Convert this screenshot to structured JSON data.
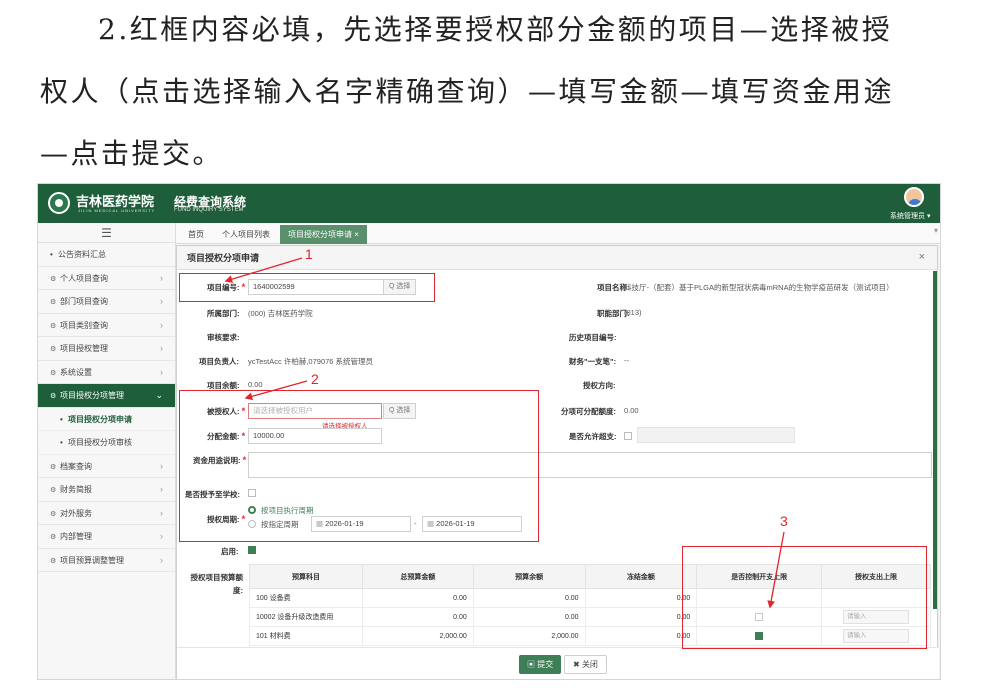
{
  "instruction": {
    "line1": "2.红框内容必填，先选择要授权部分金额的项目—选择被授",
    "line2": "权人（点击选择输入名字精确查询）—填写金额—填写资金用途",
    "line3": "—点击提交。"
  },
  "header": {
    "school_name": "吉林医药学院",
    "school_en": "JILIN MEDICAL UNIVERSITY",
    "system_title": "经费查询系统",
    "system_en": "FUND INQUIRY SYSTEM",
    "user": "系统管理员 ▾"
  },
  "sidebar": {
    "toggle": "☰",
    "items": [
      {
        "label": "公告资料汇总",
        "icon": "dot"
      },
      {
        "label": "个人项目查询",
        "icon": "gear-icon"
      },
      {
        "label": "部门项目查询",
        "icon": "gear-icon"
      },
      {
        "label": "项目类别查询",
        "icon": "gear-icon"
      },
      {
        "label": "项目授权管理",
        "icon": "gear-icon"
      },
      {
        "label": "系统设置",
        "icon": "gear-icon"
      },
      {
        "label": "项目授权分项管理",
        "icon": "gear-icon"
      },
      {
        "label": "项目授权分项申请",
        "icon": "dot"
      },
      {
        "label": "项目授权分项审核",
        "icon": "dot"
      },
      {
        "label": "档案查询",
        "icon": "gear-icon"
      },
      {
        "label": "财务简报",
        "icon": "gear-icon"
      },
      {
        "label": "对外服务",
        "icon": "gear-icon"
      },
      {
        "label": "内部管理",
        "icon": "gear-icon"
      },
      {
        "label": "项目预算调整管理",
        "icon": "gear-icon"
      }
    ]
  },
  "tabs": [
    {
      "label": "首页"
    },
    {
      "label": "个人项目列表"
    },
    {
      "label": "项目授权分项申请 ×"
    }
  ],
  "tabs_more": "▾",
  "dialog": {
    "title": "项目授权分项申请",
    "close": "×",
    "fields": {
      "project_no_label": "项目编号:",
      "project_no_value": "1640002599",
      "select_btn": "Q 选择",
      "project_name_label": "项目名称:",
      "project_name_value": "科技厅-（配套）基于PLGA的新型冠状病毒mRNA的生物学疫苗研发（测试项目）",
      "dept_label": "所属部门:",
      "dept_value": "(000) 吉林医药学院",
      "func_dept_label": "职能部门:",
      "func_dept_value": "(013)",
      "audit_label": "审核要求:",
      "history_no_label": "历史项目编号:",
      "leader_label": "项目负责人:",
      "leader_value": "ycTestAcc 许柏赫,079076 系统管理员",
      "finance_label": "财务\"一支笔\":",
      "finance_value": "--",
      "balance_label": "项目余额:",
      "balance_value": "0.00",
      "direction_label": "授权方向:",
      "grantee_label": "被授权人:",
      "grantee_placeholder": "请选择被授权用户",
      "grantee_error": "请选择被授权人",
      "allocatable_label": "分项可分配额度:",
      "allocatable_value": "0.00",
      "amount_label": "分配金额:",
      "amount_value": "10000.00",
      "overspend_label": "是否允许超支:",
      "usage_label": "资金用途说明:",
      "school_label": "是否授予至学校:",
      "period_label": "授权周期:",
      "period_opt1": "按项目执行周期",
      "period_opt2": "按指定周期",
      "date_start": "2026-01-19",
      "date_sep": "-",
      "date_end": "2026-01-19",
      "enable_label": "启用:",
      "budget_label": "授权项目预算额度:"
    },
    "table": {
      "headers": [
        "预算科目",
        "总预算金额",
        "预算余额",
        "冻结金额",
        "是否控制开支上限",
        "授权支出上限"
      ],
      "rows": [
        {
          "subject": "100 设备费",
          "total": "0.00",
          "balance": "0.00",
          "frozen": "0.00",
          "control": null,
          "limit": ""
        },
        {
          "subject": "10002 设备升级改造费用",
          "total": "0.00",
          "balance": "0.00",
          "frozen": "0.00",
          "control": false,
          "limit": "请输入"
        },
        {
          "subject": "101 材料费",
          "total": "2,000.00",
          "balance": "2,000.00",
          "frozen": "0.00",
          "control": true,
          "limit": "请输入"
        }
      ]
    },
    "submit": "提交",
    "cancel": "关闭"
  },
  "annotations": {
    "n1": "1",
    "n2": "2",
    "n3": "3"
  },
  "colors": {
    "brand_green": "#1f5e3a",
    "button_green": "#3f7f57",
    "annotation_red": "#e0262e"
  }
}
